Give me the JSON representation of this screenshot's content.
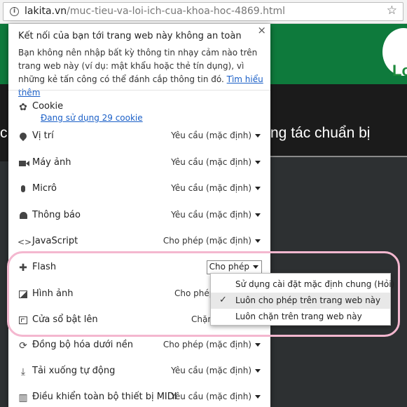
{
  "browser": {
    "url_domain": "lakita.vn",
    "url_path": "/muc-tieu-va-loi-ich-cua-khoa-hoc-4869.html"
  },
  "background": {
    "logo_fragment": "Lo",
    "headline_fragment": "ng tác chuẩn bị",
    "left_fragment": "c"
  },
  "popup": {
    "security_title": "Kết nối của bạn tới trang web này không an toàn",
    "security_body": "Bạn không nên nhập bất kỳ thông tin nhạy cảm nào trên trang web này (ví dụ: mật khẩu hoặc thẻ tín dụng), vì những kẻ tấn công có thể đánh cắp thông tin đó.",
    "learn_more": "Tìm hiểu thêm",
    "cookie_label": "Cookie",
    "cookie_link": "Đang sử dụng 29 cookie",
    "permissions": [
      {
        "label": "Vị trí",
        "value": "Yêu cầu (mặc định)"
      },
      {
        "label": "Máy ảnh",
        "value": "Yêu cầu (mặc định)"
      },
      {
        "label": "Micrô",
        "value": "Yêu cầu (mặc định)"
      },
      {
        "label": "Thông báo",
        "value": "Yêu cầu (mặc định)"
      },
      {
        "label": "JavaScript",
        "value": "Cho phép (mặc định)"
      },
      {
        "label": "Flash",
        "value": "Cho phép"
      },
      {
        "label": "Hình ảnh",
        "value": "Cho phép"
      },
      {
        "label": "Cửa sổ bật lên",
        "value": "Chặn"
      },
      {
        "label": "Đồng bộ hóa dưới nền",
        "value": "Cho phép (mặc định)"
      },
      {
        "label": "Tải xuống tự động",
        "value": "Yêu cầu (mặc định)"
      },
      {
        "label": "Điều khiển toàn bộ thiết bị MIDI",
        "value": "Yêu cầu (mặc định)"
      }
    ]
  },
  "flash_dropdown": {
    "options": [
      "Sử dụng cài đặt mặc định chung (Hỏi)",
      "Luôn cho phép trên trang web này",
      "Luôn chặn trên trang web này"
    ],
    "selected_index": 1
  }
}
